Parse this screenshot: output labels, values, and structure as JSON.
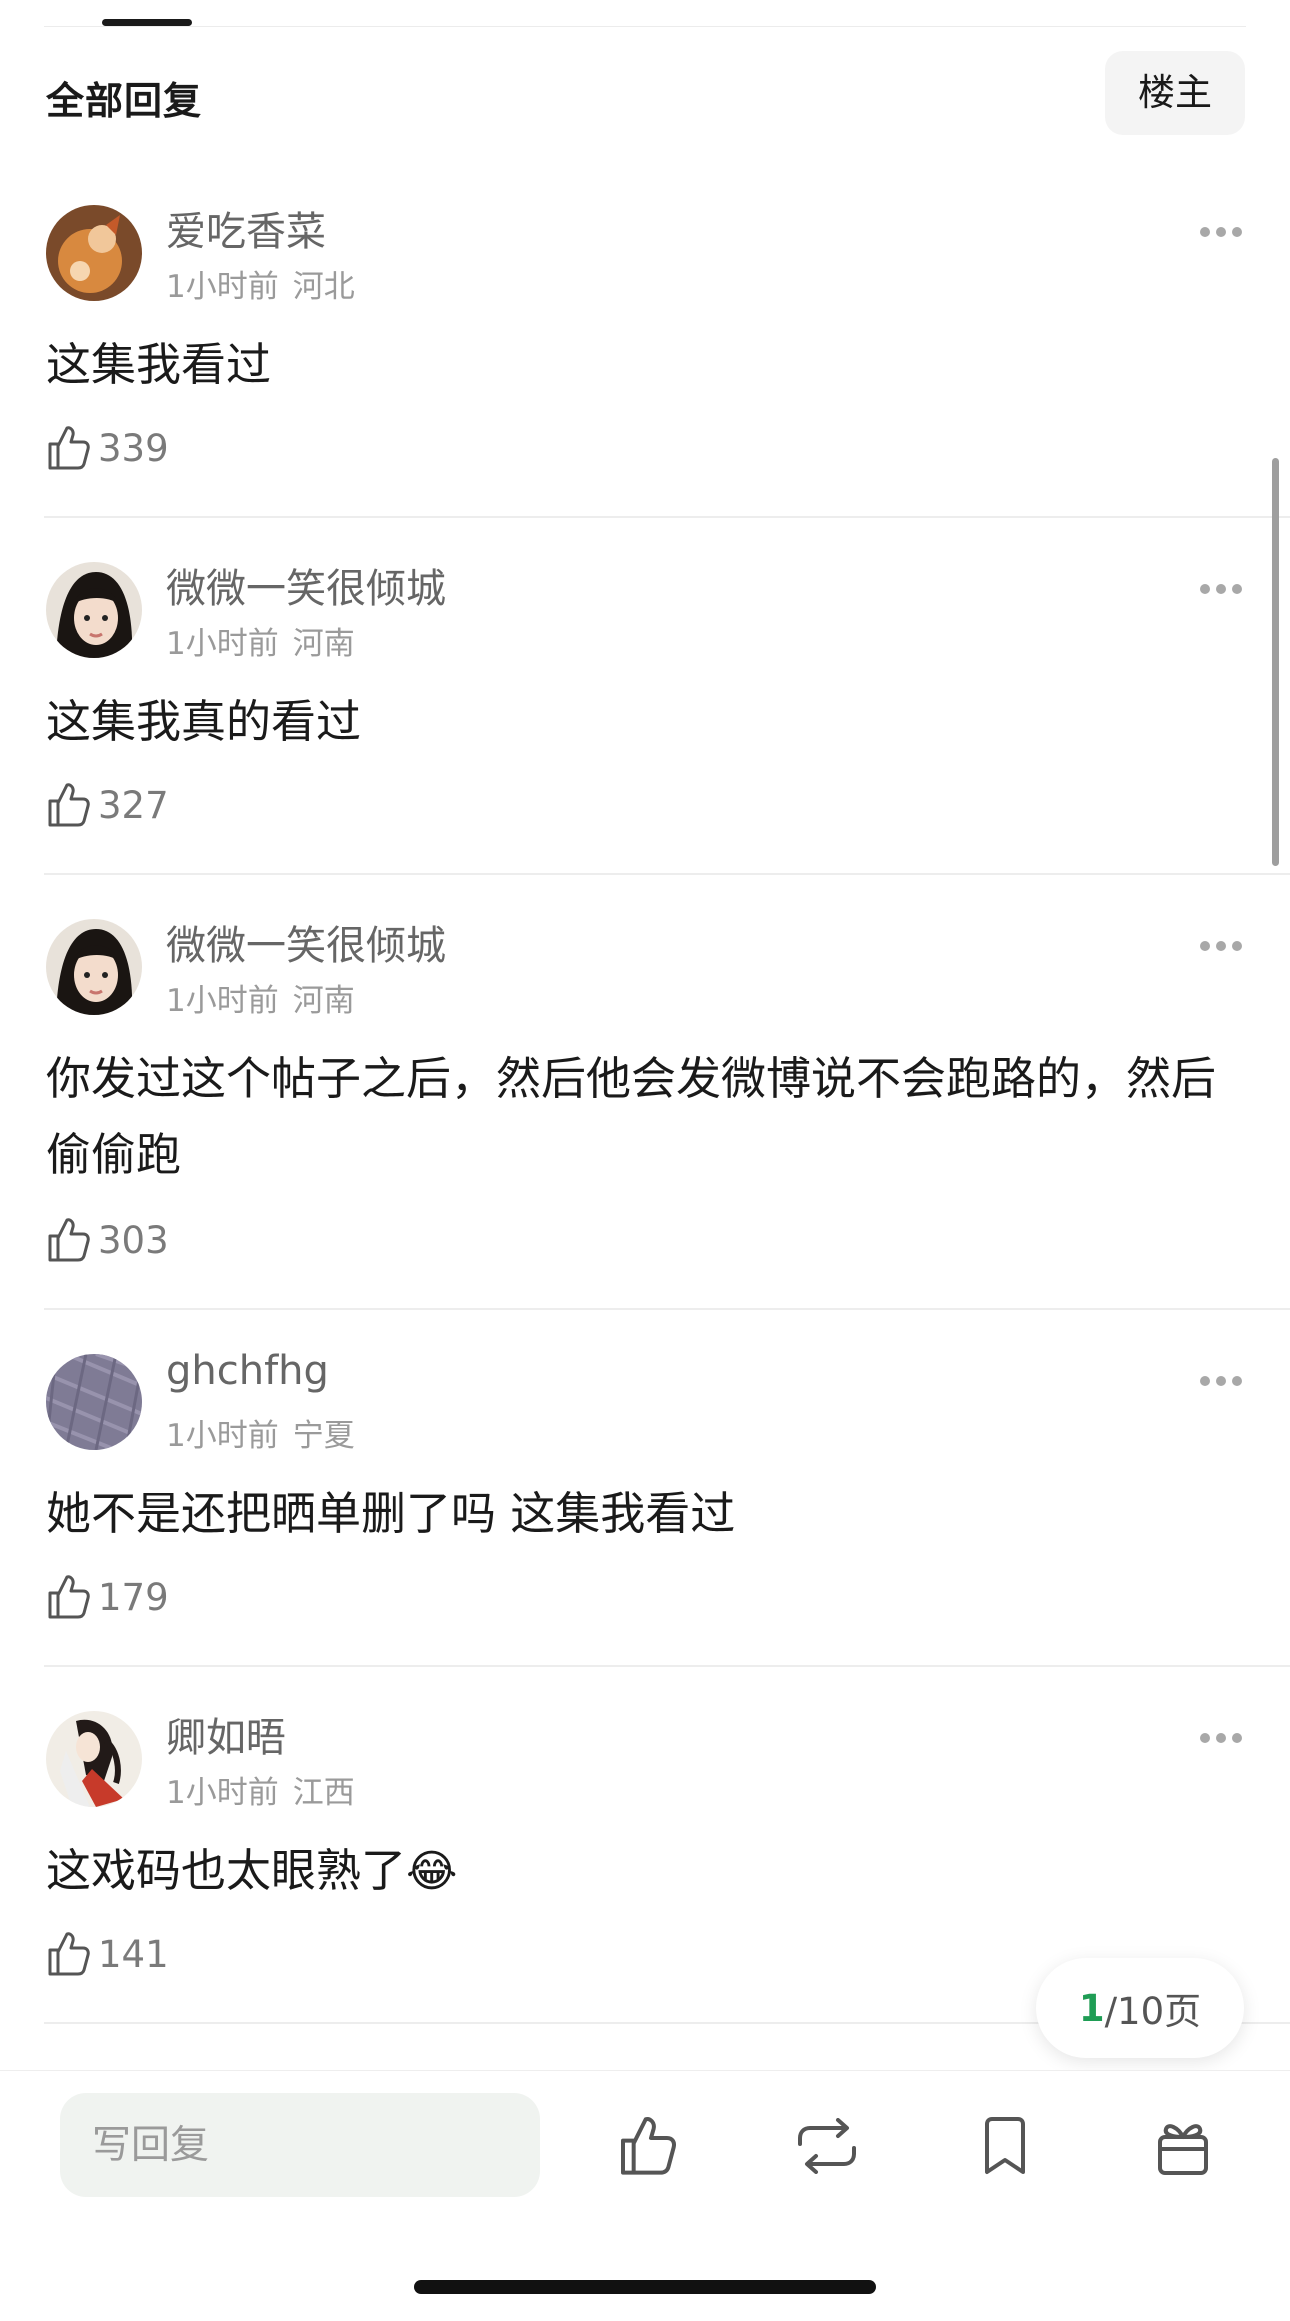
{
  "header": {
    "title": "全部回复",
    "filter_button": "楼主"
  },
  "comments": [
    {
      "username": "爱吃香菜",
      "time": "1小时前",
      "location": "河北",
      "content": "这集我看过",
      "likes": "339"
    },
    {
      "username": "微微一笑很倾城",
      "time": "1小时前",
      "location": "河南",
      "content": "这集我真的看过",
      "likes": "327"
    },
    {
      "username": "微微一笑很倾城",
      "time": "1小时前",
      "location": "河南",
      "content": "你发过这个帖子之后，然后他会发微博说不会跑路的，然后偷偷跑",
      "likes": "303"
    },
    {
      "username": "ghchfhg",
      "time": "1小时前",
      "location": "宁夏",
      "content": "她不是还把晒单删了吗 这集我看过",
      "likes": "179"
    },
    {
      "username": "卿如晤",
      "time": "1小时前",
      "location": "江西",
      "content": "这戏码也太眼熟了",
      "emoji": "😂",
      "likes": "141"
    }
  ],
  "pagination": {
    "current": "1",
    "total_text": "/10页"
  },
  "bottom_bar": {
    "reply_placeholder": "写回复"
  },
  "icons": {
    "more": "more-dots-icon",
    "like": "thumbs-up-icon",
    "repost": "repost-icon",
    "bookmark": "bookmark-icon",
    "gift": "gift-icon"
  },
  "colors": {
    "accent": "#1f9d55",
    "text_secondary": "#9a9a9a"
  }
}
